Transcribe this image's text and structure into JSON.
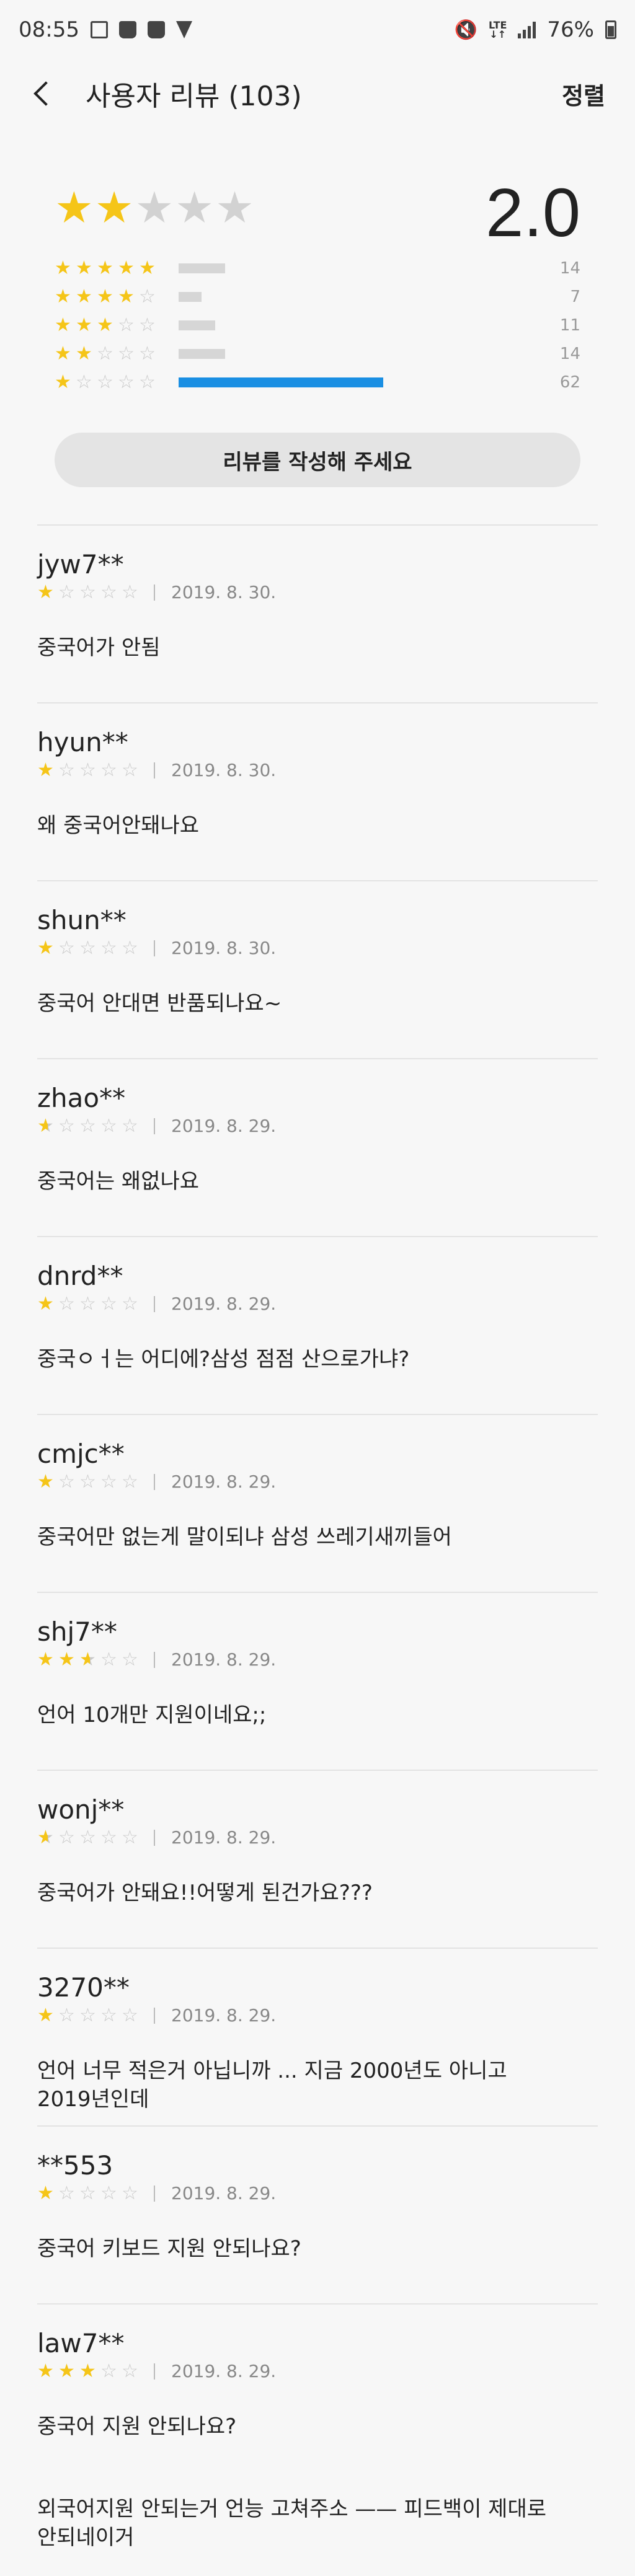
{
  "status": {
    "time": "08:55",
    "battery": "76%",
    "network": "LTE"
  },
  "header": {
    "title": "사용자 리뷰 (103)",
    "sort_label": "정렬"
  },
  "summary": {
    "average": "2.0",
    "average_value": 2.0,
    "distribution": [
      {
        "stars": 5,
        "count": "14",
        "fraction": 0.2258
      },
      {
        "stars": 4,
        "count": "7",
        "fraction": 0.1129
      },
      {
        "stars": 3,
        "count": "11",
        "fraction": 0.1774
      },
      {
        "stars": 2,
        "count": "14",
        "fraction": 0.2258
      },
      {
        "stars": 1,
        "count": "62",
        "fraction": 1.0
      }
    ],
    "write_review_label": "리뷰를 작성해 주세요"
  },
  "reviews": [
    {
      "user": "jyw7**",
      "rating": 1,
      "date": "2019. 8. 30.",
      "text": "중국어가 안됨"
    },
    {
      "user": "hyun**",
      "rating": 1,
      "date": "2019. 8. 30.",
      "text": "왜 중국어안돼나요"
    },
    {
      "user": "shun**",
      "rating": 1,
      "date": "2019. 8. 30.",
      "text": "중국어 안대면 반품되나요~"
    },
    {
      "user": "zhao**",
      "rating": 0.5,
      "date": "2019. 8. 29.",
      "text": "중국어는  왜없나요"
    },
    {
      "user": "dnrd**",
      "rating": 1,
      "date": "2019. 8. 29.",
      "text": "중국ㅇㅓ는 어디에?삼성 점점 산으로가냐?"
    },
    {
      "user": "cmjc**",
      "rating": 1,
      "date": "2019. 8. 29.",
      "text": "중국어만 없는게 말이되냐 삼성 쓰레기새끼들어"
    },
    {
      "user": "shj7**",
      "rating": 2.5,
      "date": "2019. 8. 29.",
      "text": "언어 10개만 지원이네요;;"
    },
    {
      "user": "wonj**",
      "rating": 0.5,
      "date": "2019. 8. 29.",
      "text": "중국어가 안돼요!!어떻게 된건가요???"
    },
    {
      "user": "3270**",
      "rating": 1,
      "date": "2019. 8. 29.",
      "text": "언어 너무 적은거 아닙니까  ... 지금 2000년도 아니고 2019년인데"
    },
    {
      "user": "**553",
      "rating": 1,
      "date": "2019. 8. 29.",
      "text": "중국어 키보드 지원 안되나요?"
    },
    {
      "user": "law7**",
      "rating": 3,
      "date": "2019. 8. 29.",
      "text": "중국어 지원 안되나요?"
    }
  ],
  "partial_review": {
    "text": "외국어지원 안되는거 언능 고쳐주소 —— 피드백이 제대로 안되네이거"
  },
  "colors": {
    "star": "#f5c518",
    "star_off": "#c9c9c9",
    "bar_accent": "#1a8fe3",
    "bar_base": "#d6d6d6"
  }
}
